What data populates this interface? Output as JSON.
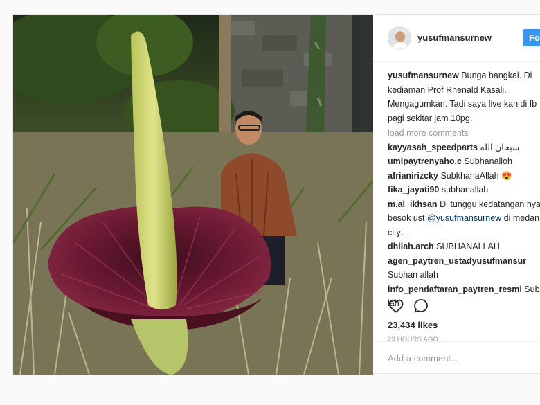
{
  "post": {
    "username": "yusufmansurnew",
    "follow_label": "Follow",
    "caption": {
      "user": "yusufmansurnew",
      "text": "Bunga bangkai. Di kediaman Prof Rhenald Kasali. Mengagumkan. Tadi saya live kan di fb pagi sekitar jam 10pg."
    },
    "load_more": "load more comments",
    "comments": [
      {
        "user": "kayyasah_speedparts",
        "text": "سبحان الله"
      },
      {
        "user": "umipaytrenyaho.c",
        "text": "Subhanalloh"
      },
      {
        "user": "afrianirizcky",
        "text": "SubkhanaAllah 😍"
      },
      {
        "user": "fika_jayati90",
        "text": "subhanallah"
      },
      {
        "user": "m.al_ikhsan",
        "text": "Di tunggu kedatangan nya besok ust",
        "mention": "@yusufmansurnew",
        "text_after": "di medan city..."
      },
      {
        "user": "dhilah.arch",
        "text": "SUBHANALLAH"
      },
      {
        "user": "agen_paytren_ustadyusufmansur",
        "text": "Subhan allah"
      },
      {
        "user": "info_pendaftaran_paytren_resmi",
        "text": "Subha lah"
      }
    ],
    "likes": "23,434 likes",
    "time_ago": "23 HOURS AGO",
    "add_comment_placeholder": "Add a comment...",
    "icons": {
      "like": "heart-icon",
      "comment": "comment-bubble-icon"
    }
  }
}
